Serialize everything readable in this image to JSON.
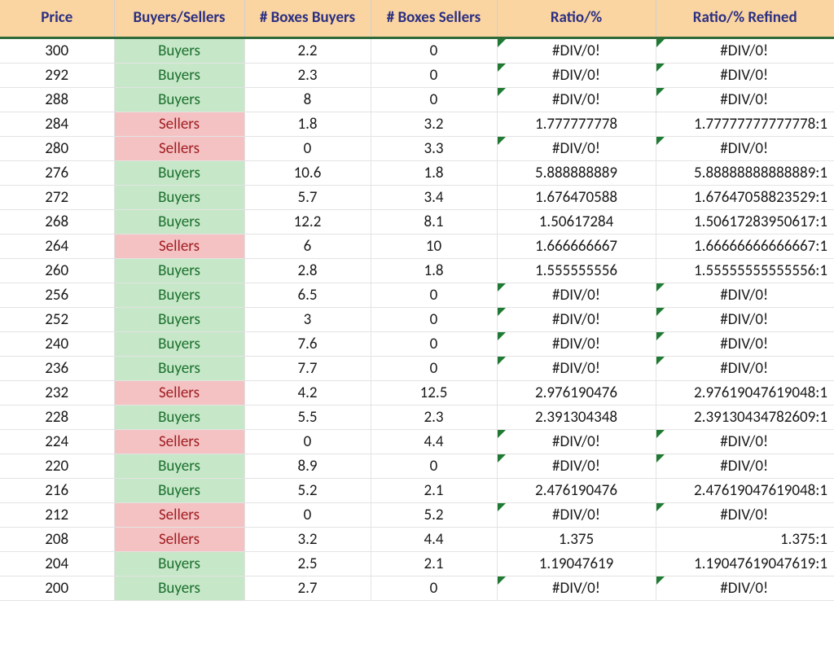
{
  "headers": {
    "price": "Price",
    "bs": "Buyers/Sellers",
    "boxes_buyers": "# Boxes Buyers",
    "boxes_sellers": "# Boxes Sellers",
    "ratio": "Ratio/%",
    "ratio_refined": "Ratio/% Refined"
  },
  "labels": {
    "buyers": "Buyers",
    "sellers": "Sellers",
    "div0": "#DIV/0!"
  },
  "rows": [
    {
      "price": "300",
      "side": "buyers",
      "boxes_buyers": "2.2",
      "boxes_sellers": "0",
      "ratio": "#DIV/0!",
      "ratio_err": true,
      "refined": "#DIV/0!",
      "refined_err": true
    },
    {
      "price": "292",
      "side": "buyers",
      "boxes_buyers": "2.3",
      "boxes_sellers": "0",
      "ratio": "#DIV/0!",
      "ratio_err": true,
      "refined": "#DIV/0!",
      "refined_err": true
    },
    {
      "price": "288",
      "side": "buyers",
      "boxes_buyers": "8",
      "boxes_sellers": "0",
      "ratio": "#DIV/0!",
      "ratio_err": true,
      "refined": "#DIV/0!",
      "refined_err": true
    },
    {
      "price": "284",
      "side": "sellers",
      "boxes_buyers": "1.8",
      "boxes_sellers": "3.2",
      "ratio": "1.777777778",
      "ratio_err": false,
      "refined": "1.77777777777778:1",
      "refined_err": false
    },
    {
      "price": "280",
      "side": "sellers",
      "boxes_buyers": "0",
      "boxes_sellers": "3.3",
      "ratio": "#DIV/0!",
      "ratio_err": true,
      "refined": "#DIV/0!",
      "refined_err": true
    },
    {
      "price": "276",
      "side": "buyers",
      "boxes_buyers": "10.6",
      "boxes_sellers": "1.8",
      "ratio": "5.888888889",
      "ratio_err": false,
      "refined": "5.88888888888889:1",
      "refined_err": false
    },
    {
      "price": "272",
      "side": "buyers",
      "boxes_buyers": "5.7",
      "boxes_sellers": "3.4",
      "ratio": "1.676470588",
      "ratio_err": false,
      "refined": "1.67647058823529:1",
      "refined_err": false
    },
    {
      "price": "268",
      "side": "buyers",
      "boxes_buyers": "12.2",
      "boxes_sellers": "8.1",
      "ratio": "1.50617284",
      "ratio_err": false,
      "refined": "1.50617283950617:1",
      "refined_err": false
    },
    {
      "price": "264",
      "side": "sellers",
      "boxes_buyers": "6",
      "boxes_sellers": "10",
      "ratio": "1.666666667",
      "ratio_err": false,
      "refined": "1.66666666666667:1",
      "refined_err": false
    },
    {
      "price": "260",
      "side": "buyers",
      "boxes_buyers": "2.8",
      "boxes_sellers": "1.8",
      "ratio": "1.555555556",
      "ratio_err": false,
      "refined": "1.55555555555556:1",
      "refined_err": false
    },
    {
      "price": "256",
      "side": "buyers",
      "boxes_buyers": "6.5",
      "boxes_sellers": "0",
      "ratio": "#DIV/0!",
      "ratio_err": true,
      "refined": "#DIV/0!",
      "refined_err": true
    },
    {
      "price": "252",
      "side": "buyers",
      "boxes_buyers": "3",
      "boxes_sellers": "0",
      "ratio": "#DIV/0!",
      "ratio_err": true,
      "refined": "#DIV/0!",
      "refined_err": true
    },
    {
      "price": "240",
      "side": "buyers",
      "boxes_buyers": "7.6",
      "boxes_sellers": "0",
      "ratio": "#DIV/0!",
      "ratio_err": true,
      "refined": "#DIV/0!",
      "refined_err": true
    },
    {
      "price": "236",
      "side": "buyers",
      "boxes_buyers": "7.7",
      "boxes_sellers": "0",
      "ratio": "#DIV/0!",
      "ratio_err": true,
      "refined": "#DIV/0!",
      "refined_err": true
    },
    {
      "price": "232",
      "side": "sellers",
      "boxes_buyers": "4.2",
      "boxes_sellers": "12.5",
      "ratio": "2.976190476",
      "ratio_err": false,
      "refined": "2.97619047619048:1",
      "refined_err": false
    },
    {
      "price": "228",
      "side": "buyers",
      "boxes_buyers": "5.5",
      "boxes_sellers": "2.3",
      "ratio": "2.391304348",
      "ratio_err": false,
      "refined": "2.39130434782609:1",
      "refined_err": false
    },
    {
      "price": "224",
      "side": "sellers",
      "boxes_buyers": "0",
      "boxes_sellers": "4.4",
      "ratio": "#DIV/0!",
      "ratio_err": true,
      "refined": "#DIV/0!",
      "refined_err": true
    },
    {
      "price": "220",
      "side": "buyers",
      "boxes_buyers": "8.9",
      "boxes_sellers": "0",
      "ratio": "#DIV/0!",
      "ratio_err": true,
      "refined": "#DIV/0!",
      "refined_err": true
    },
    {
      "price": "216",
      "side": "buyers",
      "boxes_buyers": "5.2",
      "boxes_sellers": "2.1",
      "ratio": "2.476190476",
      "ratio_err": false,
      "refined": "2.47619047619048:1",
      "refined_err": false
    },
    {
      "price": "212",
      "side": "sellers",
      "boxes_buyers": "0",
      "boxes_sellers": "5.2",
      "ratio": "#DIV/0!",
      "ratio_err": true,
      "refined": "#DIV/0!",
      "refined_err": true
    },
    {
      "price": "208",
      "side": "sellers",
      "boxes_buyers": "3.2",
      "boxes_sellers": "4.4",
      "ratio": "1.375",
      "ratio_err": false,
      "refined": "1.375:1",
      "refined_err": false
    },
    {
      "price": "204",
      "side": "buyers",
      "boxes_buyers": "2.5",
      "boxes_sellers": "2.1",
      "ratio": "1.19047619",
      "ratio_err": false,
      "refined": "1.19047619047619:1",
      "refined_err": false
    },
    {
      "price": "200",
      "side": "buyers",
      "boxes_buyers": "2.7",
      "boxes_sellers": "0",
      "ratio": "#DIV/0!",
      "ratio_err": true,
      "refined": "#DIV/0!",
      "refined_err": true
    }
  ]
}
